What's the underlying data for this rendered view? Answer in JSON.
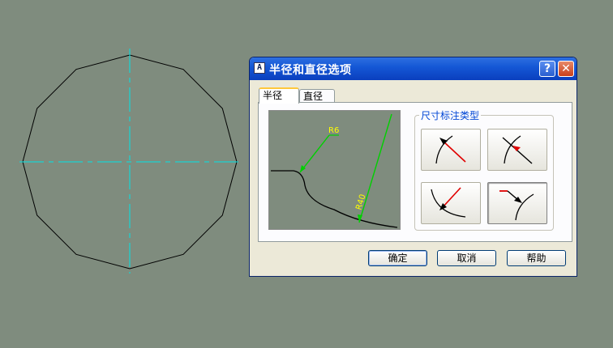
{
  "drawing": {
    "shape": "dodecagon",
    "line_color": "#000000",
    "centerline_color": "#00e5e5"
  },
  "dialog": {
    "title": "半径和直径选项",
    "icon_glyph": "A",
    "help_glyph": "?",
    "close_glyph": "✕",
    "tabs": [
      {
        "label": "半径",
        "selected": true
      },
      {
        "label": "直径",
        "selected": false
      }
    ],
    "preview": {
      "small_label": "R6",
      "large_label": "R40",
      "arrow_color": "#00d000",
      "label_color": "#ffff00"
    },
    "group_label": "尺寸标注类型",
    "type_buttons": [
      {
        "name": "arrow-inside",
        "icon": "radius-arrow-inside-icon"
      },
      {
        "name": "arrow-outside-red",
        "icon": "radius-arrow-outside-icon"
      },
      {
        "name": "leader-inside",
        "icon": "radius-leader-inside-icon"
      },
      {
        "name": "leader-outside",
        "icon": "radius-leader-outside-icon"
      }
    ],
    "buttons": {
      "ok": "确定",
      "cancel": "取消",
      "help": "帮助"
    }
  }
}
